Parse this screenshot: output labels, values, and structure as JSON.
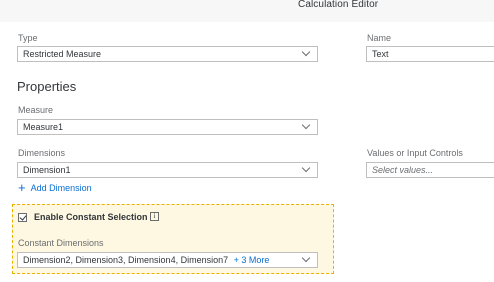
{
  "dialog": {
    "title": "Calculation Editor"
  },
  "type": {
    "label": "Type",
    "value": "Restricted Measure"
  },
  "name": {
    "label": "Name",
    "value": "Text"
  },
  "properties": {
    "heading": "Properties"
  },
  "measure": {
    "label": "Measure",
    "value": "Measure1"
  },
  "dimensions": {
    "label": "Dimensions",
    "value": "Dimension1",
    "add_label": "Add Dimension"
  },
  "values_input": {
    "label": "Values or Input Controls",
    "placeholder": "Select values..."
  },
  "constant": {
    "checkbox_label": "Enable Constant Selection",
    "checked": true,
    "info_glyph": "i",
    "dims_label": "Constant Dimensions",
    "dims_value": "Dimension2, Dimension3, Dimension4, Dimension7",
    "more_label": "+ 3 More"
  },
  "colors": {
    "link": "#0a6ed1",
    "panel_bg": "#fef8e2",
    "panel_border": "#e9b200"
  }
}
